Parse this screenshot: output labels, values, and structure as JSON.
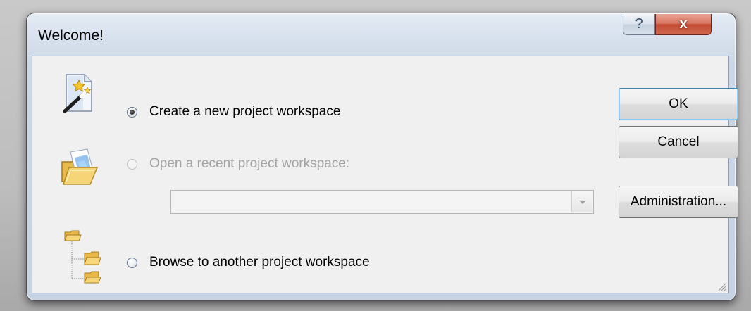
{
  "window": {
    "title": "Welcome!",
    "help_glyph": "?",
    "close_glyph": "x"
  },
  "options": {
    "create_new": {
      "label": "Create a new project workspace",
      "selected": true,
      "enabled": true,
      "icon": "wizard-wand-icon"
    },
    "open_recent": {
      "label": "Open a recent project workspace:",
      "selected": false,
      "enabled": false,
      "icon": "open-folder-icon"
    },
    "browse": {
      "label": "Browse to another project workspace",
      "selected": false,
      "enabled": true,
      "icon": "folder-tree-icon"
    }
  },
  "recent_combo": {
    "value": ""
  },
  "buttons": {
    "ok": "OK",
    "cancel": "Cancel",
    "administration": "Administration..."
  }
}
